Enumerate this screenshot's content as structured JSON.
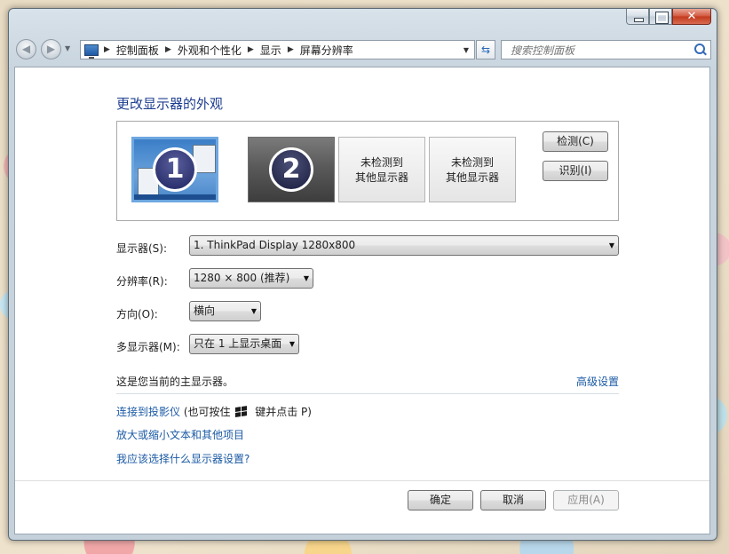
{
  "window": {
    "min_label": "",
    "max_label": "",
    "close_label": "✕"
  },
  "nav": {
    "back_icon": "back-arrow-icon",
    "forward_icon": "forward-arrow-icon",
    "breadcrumbs": [
      "控制面板",
      "外观和个性化",
      "显示",
      "屏幕分辨率"
    ],
    "search_placeholder": "搜索控制面板"
  },
  "page": {
    "title": "更改显示器的外观"
  },
  "preview": {
    "monitor1_number": "1",
    "monitor2_number": "2",
    "undetected_line1": "未检测到",
    "undetected_line2": "其他显示器",
    "detect_button": "检测(C)",
    "identify_button": "识别(I)"
  },
  "settings": {
    "display_label": "显示器(S):",
    "display_value": "1. ThinkPad Display 1280x800",
    "resolution_label": "分辨率(R):",
    "resolution_value": "1280 × 800 (推荐)",
    "orientation_label": "方向(O):",
    "orientation_value": "横向",
    "multi_label": "多显示器(M):",
    "multi_value": "只在 1 上显示桌面"
  },
  "status": {
    "primary_text": "这是您当前的主显示器。",
    "advanced_link": "高级设置"
  },
  "links": {
    "projector_link": "连接到投影仪",
    "projector_hint_pre": "(也可按住",
    "projector_hint_post": "键并点击 P)",
    "text_size_link": "放大或缩小文本和其他项目",
    "which_settings_link": "我应该选择什么显示器设置?"
  },
  "footer": {
    "ok": "确定",
    "cancel": "取消",
    "apply": "应用(A)"
  }
}
